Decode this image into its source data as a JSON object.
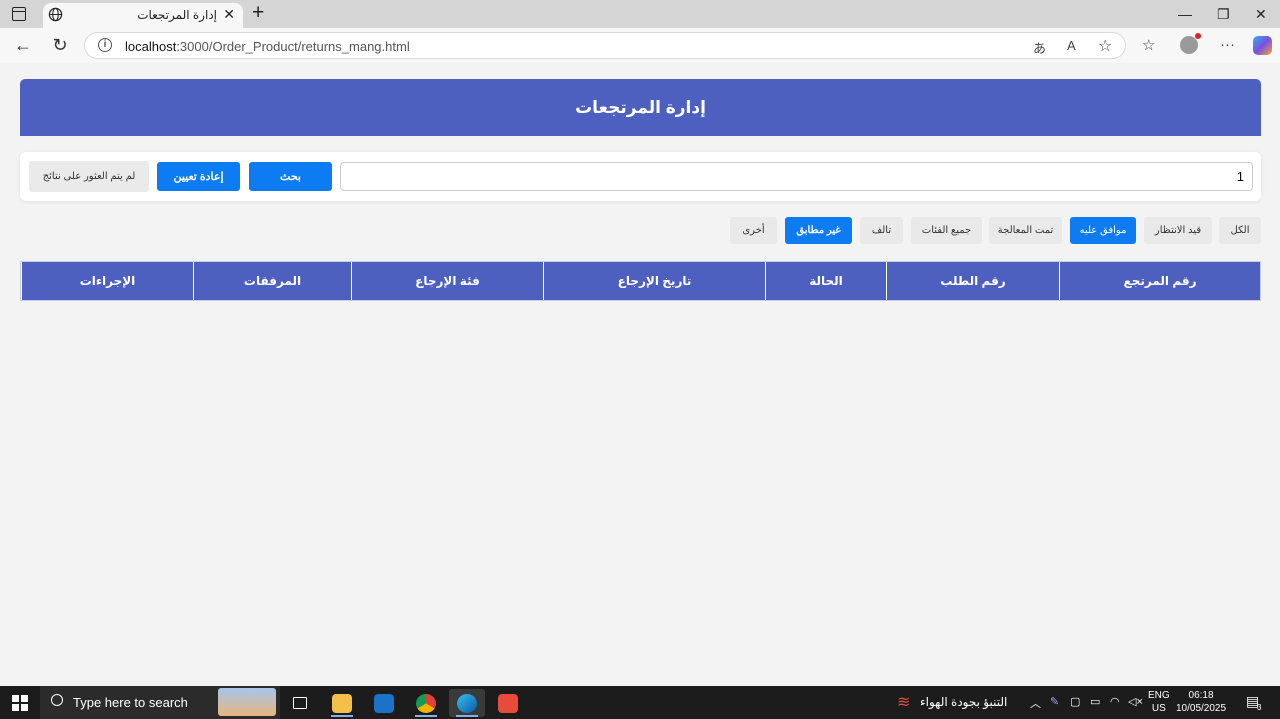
{
  "browser": {
    "tab_title": "إدارة المرتجعات",
    "url_host": "localhost",
    "url_path": ":3000/Order_Product/returns_mang.html"
  },
  "page": {
    "title": "إدارة المرتجعات",
    "search": {
      "value": "1",
      "search_button": "بحث",
      "reset_button": "إعادة تعيين",
      "no_results": "لم يتم العثور على نتائج"
    },
    "filters": [
      {
        "label": "الكل",
        "active": false
      },
      {
        "label": "قيد الانتظار",
        "active": false
      },
      {
        "label": "موافق عليه",
        "active": true
      },
      {
        "label": "تمت المعالجة",
        "active": false
      },
      {
        "label": "جميع الفئات",
        "active": false
      },
      {
        "label": "تالف",
        "active": false
      },
      {
        "label": "غير مطابق",
        "active": true
      },
      {
        "label": "أخرى",
        "active": false
      }
    ],
    "table_headers": [
      "رقم المرتجع",
      "رقم الطلب",
      "الحالة",
      "تاريخ الإرجاع",
      "فئة الإرجاع",
      "المرفقات",
      "الإجراءات"
    ]
  },
  "taskbar": {
    "search_placeholder": "Type here to search",
    "weather": "التنبؤ بجودة الهواء",
    "lang_top": "ENG",
    "lang_bottom": "US",
    "time": "06:18",
    "date": "10/05/2025",
    "notification_count": "3"
  },
  "colors": {
    "header": "#4d5fbf",
    "accent": "#0d7bf2"
  }
}
